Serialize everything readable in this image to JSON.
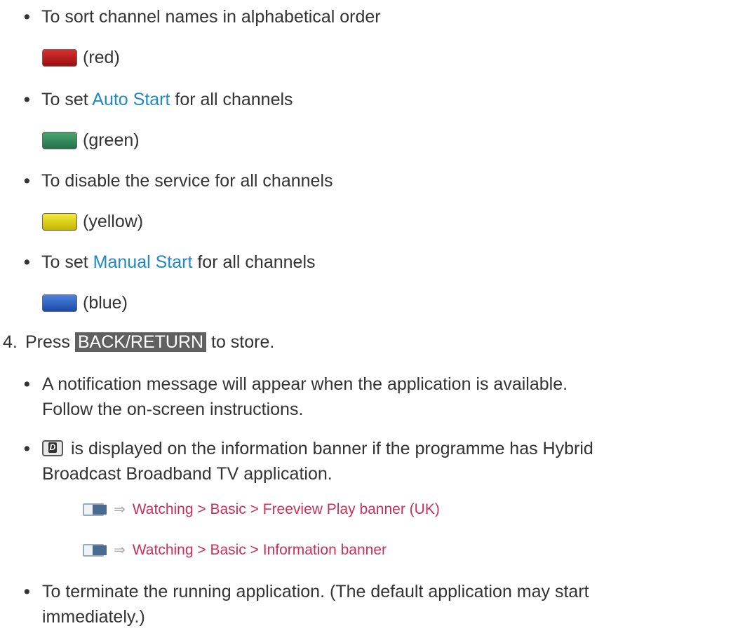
{
  "bullets_top": [
    {
      "text": "To sort channel names in alphabetical order",
      "key": "(red)"
    },
    {
      "pre": "To set ",
      "link": "Auto Start",
      "post": " for all channels",
      "key": "(green)"
    },
    {
      "text": "To disable the service for all channels",
      "key": "(yellow)"
    },
    {
      "pre": "To set ",
      "link": "Manual Start",
      "post": " for all channels",
      "key": "(blue)"
    }
  ],
  "step4": {
    "number": "4.",
    "pre": "Press ",
    "key": "BACK/RETURN",
    "post": " to store."
  },
  "notes": {
    "note1_line1": "A notification message will appear when the application is available.",
    "note1_line2": "Follow the on-screen instructions.",
    "note2_line1": " is displayed on the information banner if the programme has Hybrid",
    "note2_line2": "Broadcast Broadband TV application.",
    "note2_icon_letter": "D",
    "note3_line1": "To terminate the running application. (The default application may start",
    "note3_line2": "immediately.)"
  },
  "references": [
    {
      "text": "Watching > Basic > Freeview Play banner (UK)"
    },
    {
      "text": "Watching > Basic > Information banner"
    }
  ],
  "bullet_glyph": "•",
  "arrow_glyph": "⇒",
  "colors": {
    "text": "#333333",
    "link": "#1e88c8",
    "reference": "#c8305a",
    "key_highlight": "#606060"
  }
}
